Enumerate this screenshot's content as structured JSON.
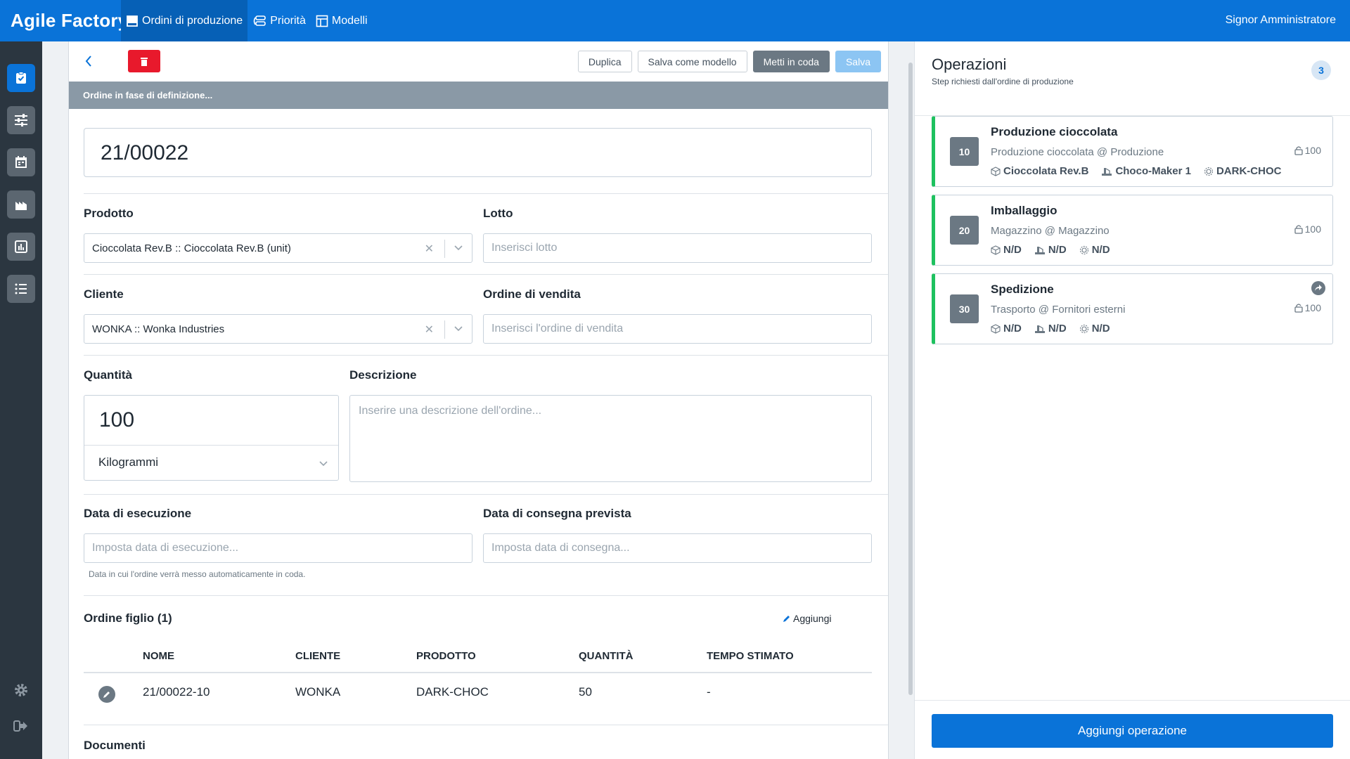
{
  "topbar": {
    "brand": "Agile Factory",
    "nav": [
      {
        "label": "Ordini di produzione",
        "icon": "document-icon",
        "active": true
      },
      {
        "label": "Priorità",
        "icon": "queue-icon",
        "active": false
      },
      {
        "label": "Modelli",
        "icon": "template-icon",
        "active": false
      }
    ],
    "user": "Signor Amministratore"
  },
  "sidebar": {
    "items": [
      "checklist-icon",
      "sliders-icon",
      "calendar-icon",
      "factory-icon",
      "chart-icon",
      "list-icon"
    ],
    "bottom": [
      "gear-icon",
      "logout-icon"
    ]
  },
  "toolbar": {
    "duplicate": "Duplica",
    "save_template": "Salva come modello",
    "enqueue": "Metti in coda",
    "save": "Salva"
  },
  "status": "Ordine in fase di definizione...",
  "order": {
    "number": "21/00022",
    "product_label": "Prodotto",
    "product_value": "Cioccolata Rev.B :: Cioccolata Rev.B (unit)",
    "lot_label": "Lotto",
    "lot_placeholder": "Inserisci lotto",
    "customer_label": "Cliente",
    "customer_value": "WONKA :: Wonka Industries",
    "sales_label": "Ordine di vendita",
    "sales_placeholder": "Inserisci l'ordine di vendita",
    "quantity_label": "Quantità",
    "quantity_value": "100",
    "unit": "Kilogrammi",
    "description_label": "Descrizione",
    "description_placeholder": "Inserire una descrizione dell'ordine...",
    "exec_date_label": "Data di esecuzione",
    "exec_date_placeholder": "Imposta data di esecuzione...",
    "exec_hint": "Data in cui l'ordine verrà messo automaticamente in coda.",
    "delivery_label": "Data di consegna prevista",
    "delivery_placeholder": "Imposta data di consegna..."
  },
  "children": {
    "title": "Ordine figlio (1)",
    "add": "Aggiungi",
    "headers": [
      "NOME",
      "CLIENTE",
      "PRODOTTO",
      "QUANTITÀ",
      "TEMPO STIMATO"
    ],
    "rows": [
      {
        "name": "21/00022-10",
        "customer": "WONKA",
        "product": "DARK-CHOC",
        "qty": "50",
        "time": "-"
      }
    ]
  },
  "documents_title": "Documenti",
  "operations": {
    "title": "Operazioni",
    "subtitle": "Step richiesti dall'ordine di produzione",
    "count": "3",
    "items": [
      {
        "num": "10",
        "name": "Produzione cioccolata",
        "where": "Produzione cioccolata @ Produzione",
        "qty": "100",
        "product": "Cioccolata Rev.B",
        "machine": "Choco-Maker 1",
        "material": "DARK-CHOC"
      },
      {
        "num": "20",
        "name": "Imballaggio",
        "where": "Magazzino @ Magazzino",
        "qty": "100",
        "product": "N/D",
        "machine": "N/D",
        "material": "N/D"
      },
      {
        "num": "30",
        "name": "Spedizione",
        "where": "Trasporto @ Fornitori esterni",
        "qty": "100",
        "product": "N/D",
        "machine": "N/D",
        "material": "N/D"
      }
    ],
    "add_button": "Aggiungi operazione"
  },
  "colors": {
    "primary": "#0a73d8",
    "sidebar": "#2b3640",
    "success": "#1ec15f",
    "danger": "#e8192c"
  }
}
